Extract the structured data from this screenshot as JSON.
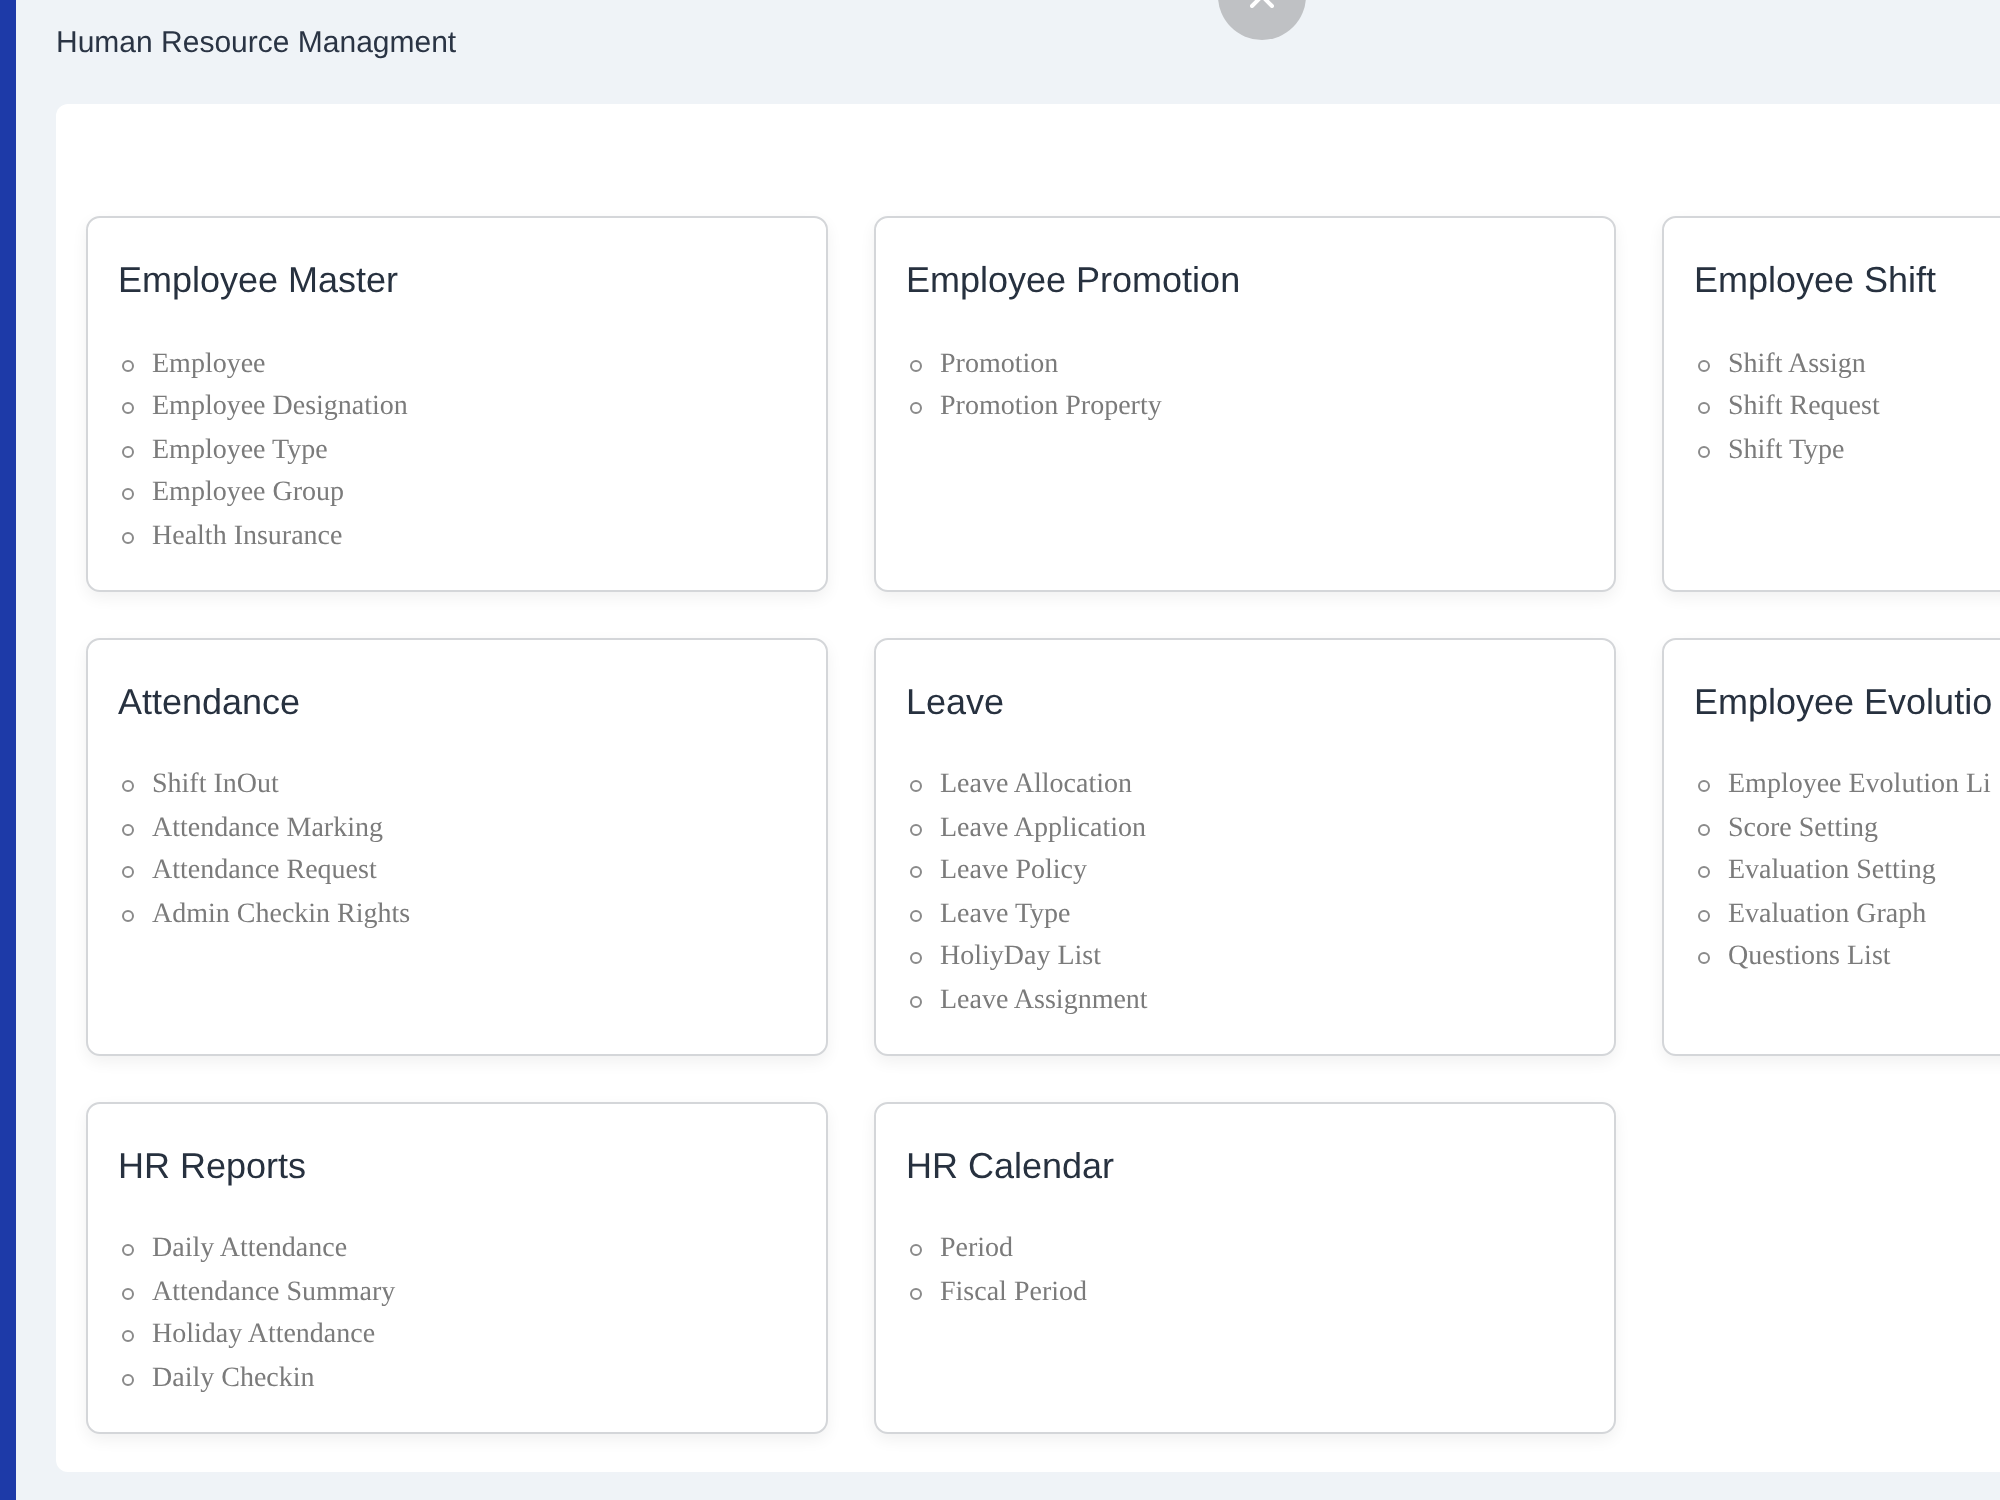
{
  "modal": {
    "title": "Human Resource Managment"
  },
  "modules": [
    {
      "title": "Employee Master",
      "items": [
        "Employee",
        "Employee Designation",
        "Employee Type",
        "Employee Group",
        "Health Insurance"
      ]
    },
    {
      "title": "Employee Promotion",
      "items": [
        "Promotion",
        "Promotion Property"
      ]
    },
    {
      "title": "Employee Shift",
      "items": [
        "Shift Assign",
        "Shift Request",
        "Shift Type"
      ]
    },
    {
      "title": "Attendance",
      "items": [
        "Shift InOut",
        "Attendance Marking",
        "Attendance Request",
        "Admin Checkin Rights"
      ]
    },
    {
      "title": "Leave",
      "items": [
        "Leave Allocation",
        "Leave Application",
        "Leave Policy",
        "Leave Type",
        "HoliyDay List",
        "Leave Assignment"
      ]
    },
    {
      "title": "Employee Evolutio",
      "items": [
        "Employee Evolution Li",
        "Score Setting",
        "Evaluation Setting",
        "Evaluation Graph",
        "Questions List"
      ]
    },
    {
      "title": "HR Reports",
      "items": [
        "Daily Attendance",
        "Attendance Summary",
        "Holiday Attendance",
        "Daily Checkin"
      ]
    },
    {
      "title": "HR Calendar",
      "items": [
        "Period",
        "Fiscal Period"
      ]
    }
  ]
}
